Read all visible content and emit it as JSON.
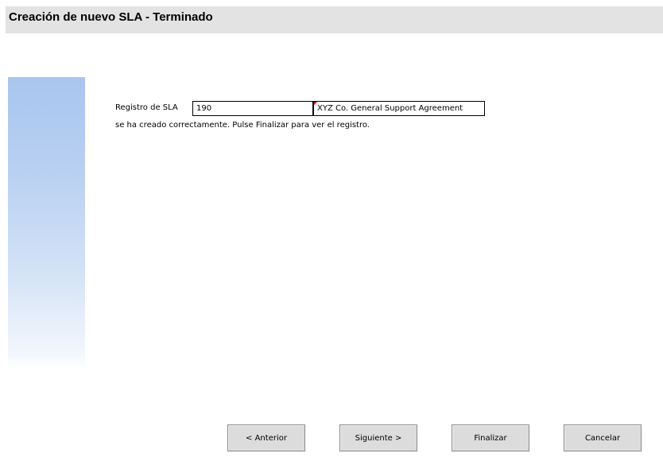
{
  "header": {
    "title": "Creación de nuevo SLA - Terminado"
  },
  "form": {
    "label": "Registro de SLA",
    "sla_id": "190",
    "sla_name": "XYZ Co. General Support Agreement",
    "message": "se ha creado correctamente. Pulse Finalizar para ver el registro."
  },
  "buttons": {
    "previous": "< Anterior",
    "next": "Siguiente >",
    "finish": "Finalizar",
    "cancel": "Cancelar"
  },
  "colors": {
    "title_bar": "#e3e3e3",
    "side_panel_top": "#a9c6ef",
    "button_face": "#dcdcdc",
    "required_marker": "#d0021b"
  }
}
